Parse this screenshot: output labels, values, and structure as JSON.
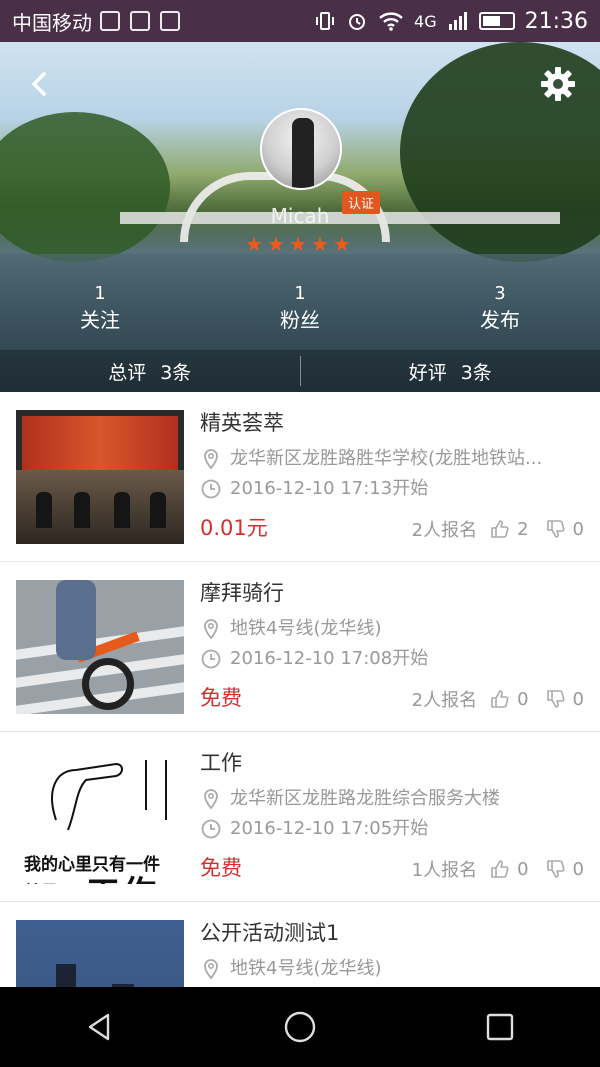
{
  "status_bar": {
    "carrier": "中国移动",
    "network": "4G",
    "time": "21:36"
  },
  "profile": {
    "username": "Micah",
    "verified_label": "认证",
    "rating_stars": 5,
    "stats": [
      {
        "value": "1",
        "label": "关注"
      },
      {
        "value": "1",
        "label": "粉丝"
      },
      {
        "value": "3",
        "label": "发布"
      }
    ],
    "evaluations": [
      {
        "label": "总评",
        "count": "3条"
      },
      {
        "label": "好评",
        "count": "3条"
      }
    ]
  },
  "events": [
    {
      "title": "精英荟萃",
      "location": "龙华新区龙胜路胜华学校(龙胜地铁站...",
      "time": "2016-12-10 17:13开始",
      "price": "0.01元",
      "signups": "2人报名",
      "likes": "2",
      "dislikes": "0"
    },
    {
      "title": "摩拜骑行",
      "location": "地铁4号线(龙华线)",
      "time": "2016-12-10 17:08开始",
      "price": "免费",
      "signups": "2人报名",
      "likes": "0",
      "dislikes": "0"
    },
    {
      "title": "工作",
      "location": "龙华新区龙胜路龙胜综合服务大楼",
      "time": "2016-12-10 17:05开始",
      "price": "免费",
      "signups": "1人报名",
      "likes": "0",
      "dislikes": "0",
      "thumb_text": {
        "line1": "我的心里只有一件",
        "line2": "就是",
        "big": "工作"
      }
    },
    {
      "title": "公开活动测试1",
      "location": "地铁4号线(龙华线)"
    }
  ],
  "colors": {
    "status_bar_bg": "#4a2f48",
    "price_red": "#d32f2f",
    "star_orange": "#f05a17",
    "verify_badge": "#e0571f"
  },
  "icons": {
    "back": "chevron-left-icon",
    "settings": "gear-icon",
    "location": "location-pin-icon",
    "time": "clock-icon",
    "like": "thumbs-up-icon",
    "dislike": "thumbs-down-icon"
  }
}
